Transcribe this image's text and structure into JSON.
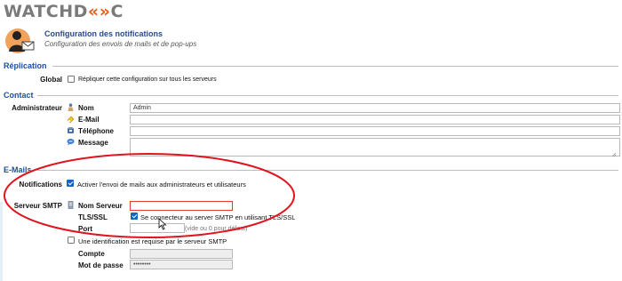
{
  "brand": {
    "part1": "WATCHD",
    "part2": "«»",
    "part3": "C"
  },
  "header": {
    "title": "Configuration des notifications",
    "subtitle": "Configuration des envois de mails et de pop-ups"
  },
  "replication": {
    "section_title": "Réplication",
    "label": "Global",
    "checkbox_label": "Répliquer cette configuration sur tous les serveurs",
    "checked": false
  },
  "contact": {
    "section_title": "Contact",
    "label": "Administrateur",
    "fields": {
      "name_label": "Nom",
      "name_value": "Admin",
      "email_label": "E-Mail",
      "email_value": "",
      "phone_label": "Téléphone",
      "phone_value": "",
      "message_label": "Message",
      "message_value": ""
    }
  },
  "emails": {
    "section_title": "E-Mails",
    "notifications_label": "Notifications",
    "notifications_checkbox": "Activer l'envoi de mails aux administrateurs et utilisateurs",
    "notifications_checked": true,
    "smtp_label": "Serveur SMTP",
    "server_name_label": "Nom Serveur",
    "server_name_value": "",
    "tls_label": "TLS/SSL",
    "tls_checkbox": "Se connecteur au server SMTP en utilisant TLS/SSL",
    "tls_checked": true,
    "port_label": "Port",
    "port_value": "",
    "port_hint": "(vide ou 0 pour défaut)",
    "auth_checkbox": "Une identification est requise par le serveur SMTP",
    "auth_checked": false,
    "account_label": "Compte",
    "account_value": "",
    "password_label": "Mot de passe",
    "password_value": "••••••••"
  },
  "colors": {
    "accent": "#1f4e9a",
    "brand_orange": "#e8601c",
    "annotation_red": "#e0141e"
  }
}
